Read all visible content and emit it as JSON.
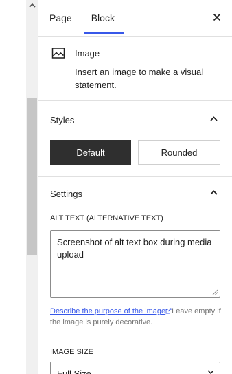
{
  "tabs": [
    {
      "label": "Page"
    },
    {
      "label": "Block"
    }
  ],
  "block": {
    "title": "Image",
    "description": "Insert an image to make a visual statement."
  },
  "styles": {
    "heading": "Styles",
    "options": [
      "Default",
      "Rounded"
    ],
    "selected": "Default"
  },
  "settings": {
    "heading": "Settings",
    "alt_label": "ALT TEXT (ALTERNATIVE TEXT)",
    "alt_value": "Screenshot of alt text box during media upload",
    "help_link": "Describe the purpose of the image",
    "help_rest": "Leave empty if the image is purely decorative.",
    "size_label": "IMAGE SIZE",
    "size_value": "Full Size"
  },
  "colors": {
    "accent": "#3858e9",
    "selected_button": "#2f2f2f"
  },
  "icons": [
    "chevron-up-icon",
    "close-icon",
    "image-icon",
    "external-link-icon",
    "resize-handle-icon",
    "chevron-down-icon"
  ]
}
